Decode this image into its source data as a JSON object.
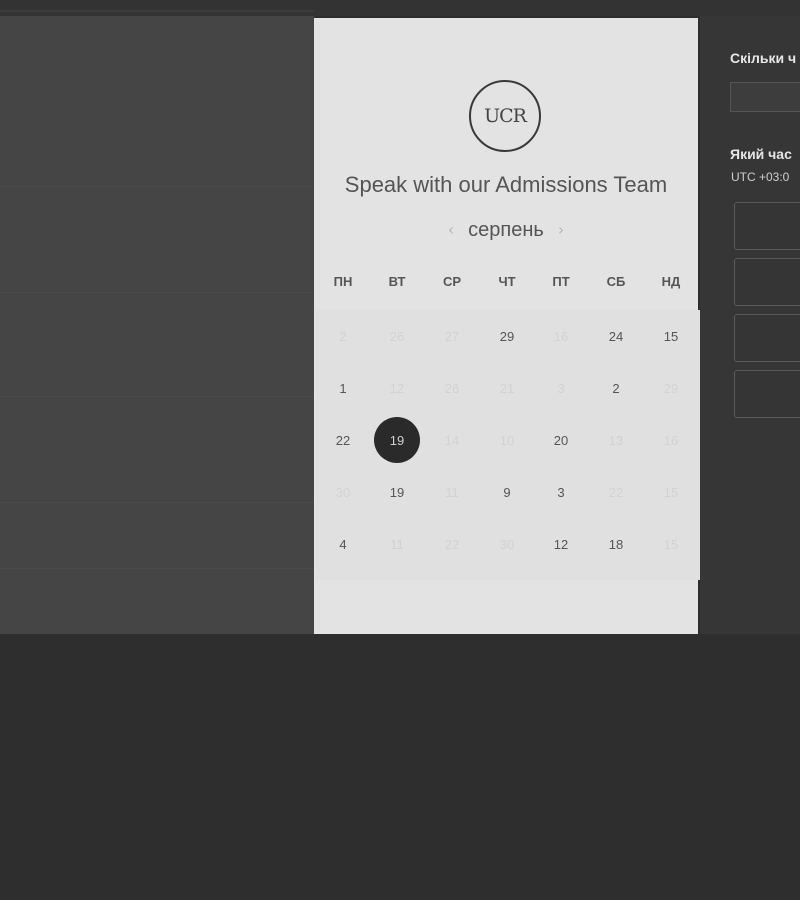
{
  "calendar": {
    "title": "Speak with our Admissions Team",
    "logo_text": "UCR",
    "month": "серпень",
    "prev_glyph": "‹",
    "next_glyph": "›",
    "weekdays": [
      "ПН",
      "ВТ",
      "СР",
      "ЧТ",
      "ПТ",
      "СБ",
      "НД"
    ],
    "rows": [
      [
        {
          "label": "2",
          "active": false
        },
        {
          "label": "26",
          "active": false
        },
        {
          "label": "27",
          "active": false
        },
        {
          "label": "29",
          "active": true
        },
        {
          "label": "16",
          "active": false
        },
        {
          "label": "24",
          "active": true
        },
        {
          "label": "15",
          "active": true
        }
      ],
      [
        {
          "label": "1",
          "active": true
        },
        {
          "label": "12",
          "active": false
        },
        {
          "label": "26",
          "active": false
        },
        {
          "label": "21",
          "active": false
        },
        {
          "label": "3",
          "active": false
        },
        {
          "label": "2",
          "active": true
        },
        {
          "label": "29",
          "active": false
        }
      ],
      [
        {
          "label": "22",
          "active": true
        },
        {
          "label": "19",
          "active": true,
          "selected": true
        },
        {
          "label": "14",
          "active": false
        },
        {
          "label": "10",
          "active": false
        },
        {
          "label": "20",
          "active": true
        },
        {
          "label": "13",
          "active": false
        },
        {
          "label": "16",
          "active": false
        }
      ],
      [
        {
          "label": "30",
          "active": false
        },
        {
          "label": "19",
          "active": true
        },
        {
          "label": "11",
          "active": false
        },
        {
          "label": "9",
          "active": true
        },
        {
          "label": "3",
          "active": true
        },
        {
          "label": "22",
          "active": false
        },
        {
          "label": "15",
          "active": false
        }
      ],
      [
        {
          "label": "4",
          "active": true
        },
        {
          "label": "11",
          "active": false
        },
        {
          "label": "22",
          "active": false
        },
        {
          "label": "30",
          "active": false
        },
        {
          "label": "12",
          "active": true
        },
        {
          "label": "18",
          "active": true
        },
        {
          "label": "15",
          "active": false
        }
      ]
    ]
  },
  "right_panel": {
    "duration_label": "Скільки ч",
    "time_label": "Який час",
    "timezone": "UTC +03:0"
  }
}
